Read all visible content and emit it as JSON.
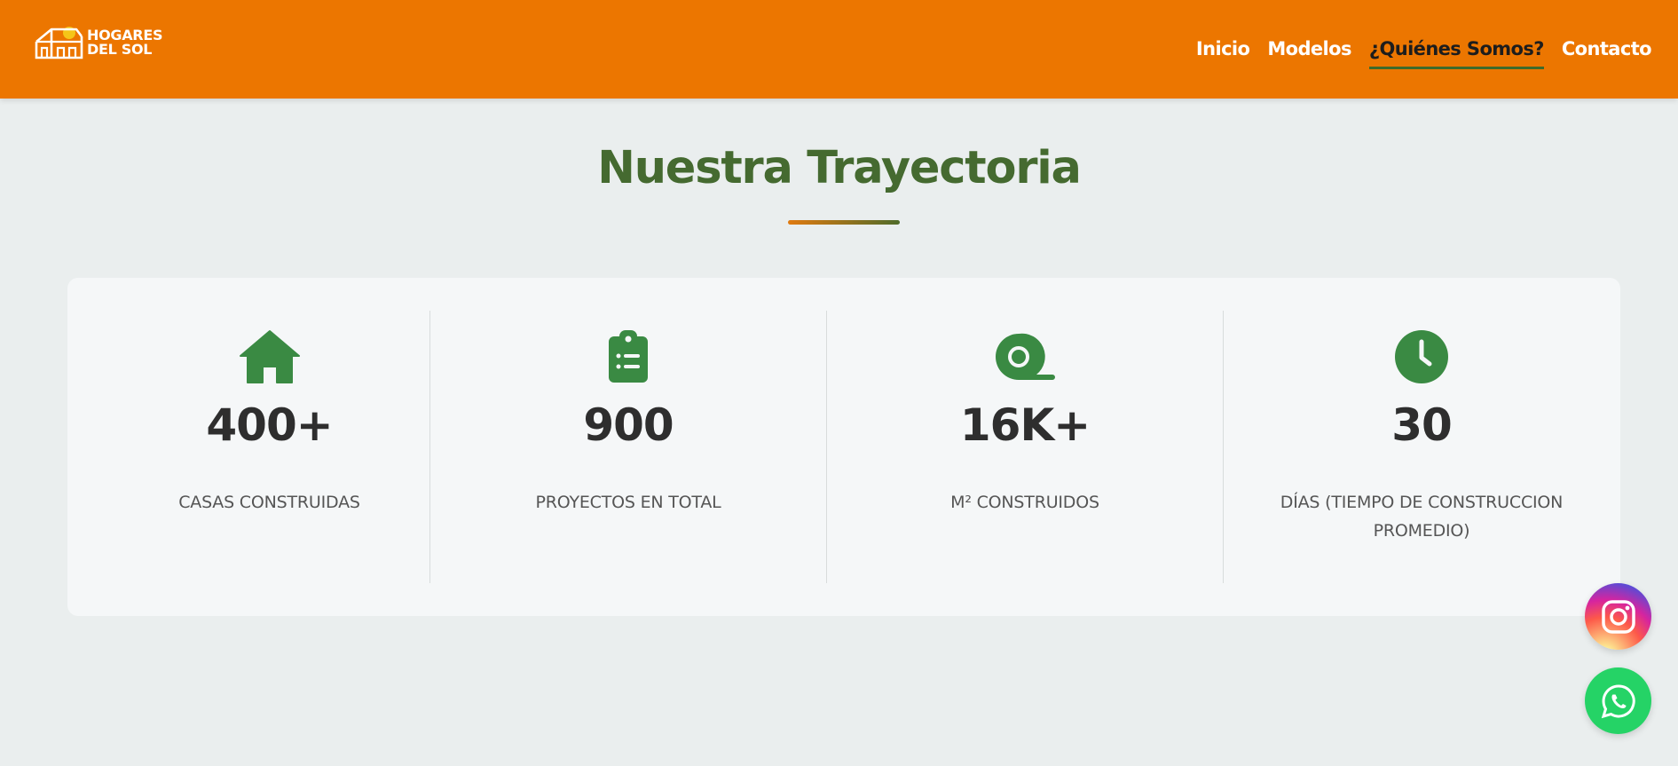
{
  "header": {
    "logo_line1": "HOGARES",
    "logo_line2": "DEL SOL",
    "nav": [
      {
        "label": "Inicio",
        "active": false
      },
      {
        "label": "Modelos",
        "active": false
      },
      {
        "label": "¿Quiénes Somos?",
        "active": true
      },
      {
        "label": "Contacto",
        "active": false
      }
    ]
  },
  "section": {
    "title": "Nuestra Trayectoria"
  },
  "stats": [
    {
      "icon": "house-icon",
      "value": "400+",
      "label": "CASAS CONSTRUIDAS"
    },
    {
      "icon": "clipboard-list-icon",
      "value": "900",
      "label": "PROYECTOS EN TOTAL"
    },
    {
      "icon": "tape-roll-icon",
      "value": "16K+",
      "label": "M² CONSTRUIDOS"
    },
    {
      "icon": "clock-icon",
      "value": "30",
      "label": "DÍAS (TIEMPO DE CONSTRUCCION PROMEDIO)"
    }
  ],
  "floating": {
    "instagram_icon": "instagram-icon",
    "whatsapp_icon": "whatsapp-icon"
  },
  "colors": {
    "header_bg": "#ec7600",
    "title_green": "#456a30",
    "icon_green": "#3a8a43",
    "page_bg": "#eaeeee",
    "whatsapp": "#25d366"
  }
}
